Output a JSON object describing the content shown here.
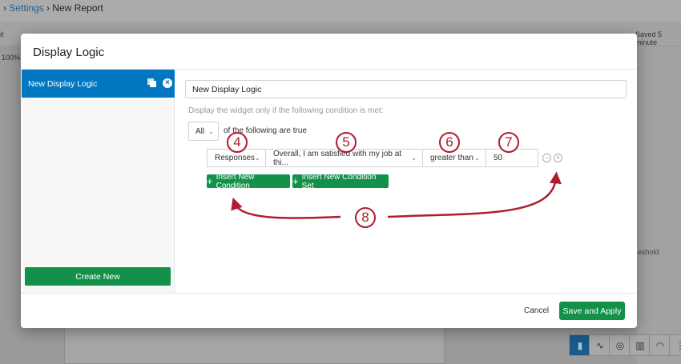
{
  "background": {
    "breadcrumb": [
      "Settings",
      "New Report"
    ],
    "toolbar_left": "it",
    "zoom": "100%",
    "saved": "Saved 5 minute",
    "threshold_fragment": "eshold"
  },
  "modal": {
    "title": "Display Logic",
    "sidebar": {
      "items": [
        {
          "label": "New Display Logic"
        }
      ],
      "create_label": "Create New"
    },
    "name_value": "New Display Logic",
    "help_text": "Display the widget only if the following condition is met:",
    "conjunction": "All",
    "conjunction_suffix": "of the following are true",
    "condition": {
      "source": "Responses",
      "question": "Overall, I am satisfied with my job at thi...",
      "operator": "greater than",
      "value": "50"
    },
    "insert_condition": "Insert New Condition",
    "insert_condition_set": "Insert New Condition Set",
    "cancel": "Cancel",
    "save": "Save and Apply"
  },
  "annotations": [
    "4",
    "5",
    "6",
    "7",
    "8"
  ],
  "colors": {
    "primary": "#0077c0",
    "success": "#13914b",
    "annotation": "#b01c2e"
  }
}
